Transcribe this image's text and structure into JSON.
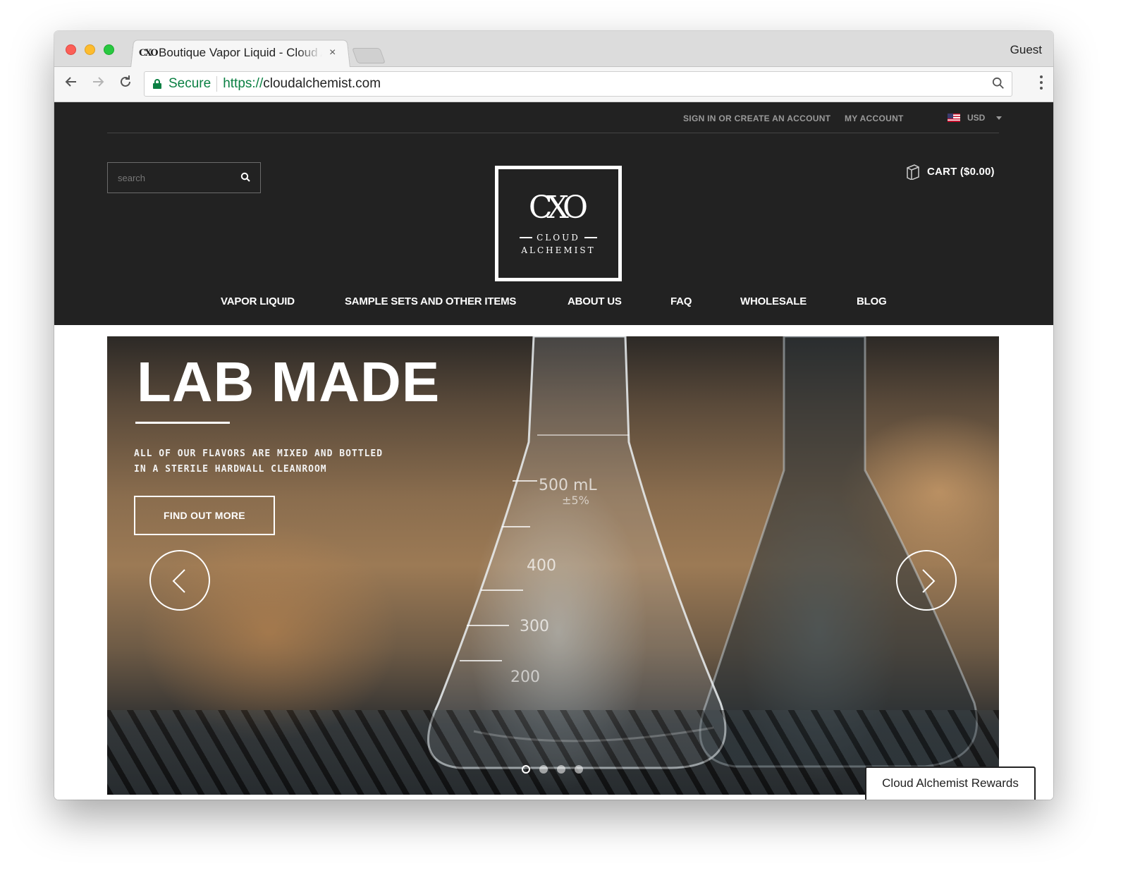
{
  "browser": {
    "tab_title": "Boutique Vapor Liquid - Cloud Alchemist",
    "tab_favicon_text": "CXO",
    "tab_close": "×",
    "profile": "Guest",
    "secure_label": "Secure",
    "url_scheme": "https://",
    "url_host": "cloudalchemist.com",
    "accent_secure": "#0b8043"
  },
  "topbar": {
    "signin": "SIGN IN OR CREATE AN ACCOUNT",
    "account": "MY ACCOUNT",
    "currency": "USD"
  },
  "header": {
    "search_placeholder": "search",
    "logo_mark": "CXO",
    "logo_line1": "CLOUD",
    "logo_line2": "ALCHEMIST",
    "cart": "CART ($0.00)",
    "background": "#222222"
  },
  "nav": {
    "items": [
      {
        "label": "VAPOR LIQUID"
      },
      {
        "label": "SAMPLE SETS AND OTHER ITEMS"
      },
      {
        "label": "ABOUT US"
      },
      {
        "label": "FAQ"
      },
      {
        "label": "WHOLESALE"
      },
      {
        "label": "BLOG"
      }
    ]
  },
  "hero": {
    "title": "LAB MADE",
    "sub_line1": "ALL OF OUR FLAVORS ARE MIXED AND BOTTLED",
    "sub_line2": "IN A STERILE HARDWALL CLEANROOM",
    "button": "FIND OUT MORE",
    "flask_marks": [
      "500 mL",
      "±5%",
      "400",
      "300",
      "200"
    ],
    "slide_count": 4,
    "active_slide": 1
  },
  "rewards": {
    "label": "Cloud Alchemist Rewards"
  }
}
